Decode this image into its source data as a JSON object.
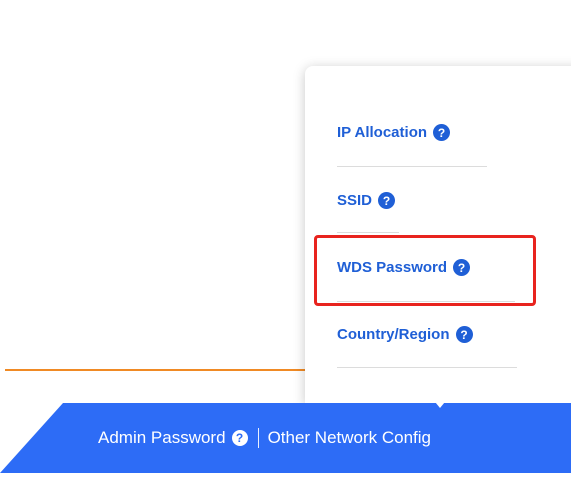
{
  "bottom_bar": {
    "color": "#2d6cf6",
    "items": [
      {
        "label": "Admin Password",
        "icon": "help-icon"
      },
      {
        "label": "Other Network Config"
      }
    ]
  },
  "divider_color": "#f08a24",
  "popover": {
    "items": [
      {
        "label": "IP Allocation",
        "icon": "help-icon"
      },
      {
        "label": "SSID",
        "icon": "help-icon"
      },
      {
        "label": "WDS Password",
        "icon": "help-icon",
        "highlighted": true
      },
      {
        "label": "Country/Region",
        "icon": "help-icon"
      }
    ]
  },
  "help_glyph": "?",
  "highlight_color": "#e8231e"
}
